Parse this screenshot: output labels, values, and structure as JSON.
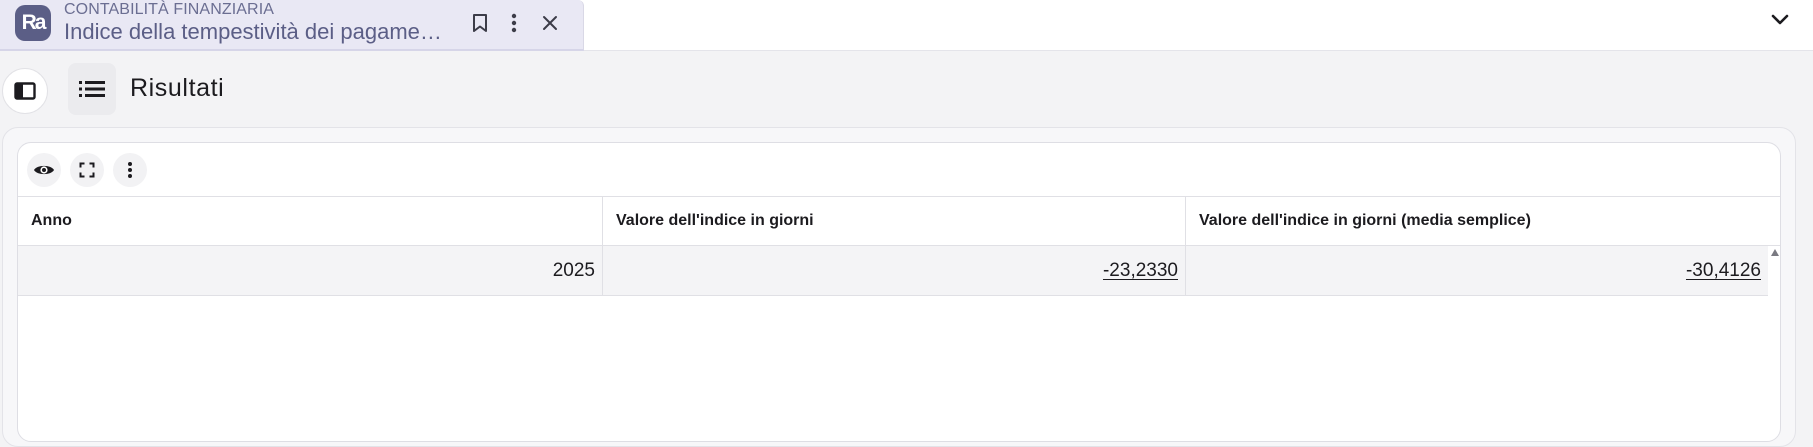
{
  "tab": {
    "app_logo": "Ra",
    "section": "CONTABILITÀ FINANZIARIA",
    "title": "Indice della tempestività dei pagame…",
    "icons": [
      "bookmark-icon",
      "more-vert-icon",
      "close-icon"
    ]
  },
  "header": {
    "title": "Risultati",
    "icons": [
      "sidebar-toggle-icon",
      "list-icon"
    ]
  },
  "toolbar": {
    "icons": [
      "eye-icon",
      "fullscreen-icon",
      "more-vert-icon"
    ]
  },
  "table": {
    "columns": [
      "Anno",
      "Valore dell'indice in giorni",
      "Valore dell'indice in giorni (media semplice)"
    ],
    "rows": [
      [
        "2025",
        "-23,2330",
        "-30,4126"
      ]
    ]
  },
  "colors": {
    "accent": "#5b5e86",
    "tab_background": "#e9e8f4"
  }
}
